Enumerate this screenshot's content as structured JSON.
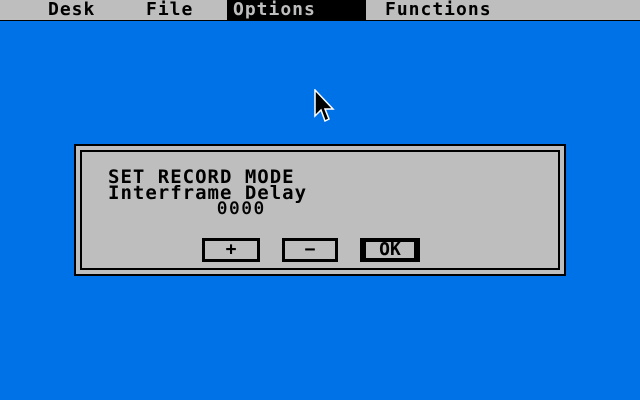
{
  "menubar": {
    "items": [
      {
        "label": "Desk"
      },
      {
        "label": "File"
      },
      {
        "label": "Options",
        "active": true
      },
      {
        "label": "Functions"
      }
    ]
  },
  "dialog": {
    "title": "SET RECORD MODE",
    "field_label": "Interframe Delay",
    "field_value": "0000",
    "buttons": {
      "plus": "+",
      "minus": "−",
      "ok": "OK"
    }
  },
  "colors": {
    "desktop": "#0072e8",
    "chrome": "#bebebe",
    "ink": "#000000"
  },
  "icons": {
    "cursor": "arrow-cursor-icon"
  }
}
